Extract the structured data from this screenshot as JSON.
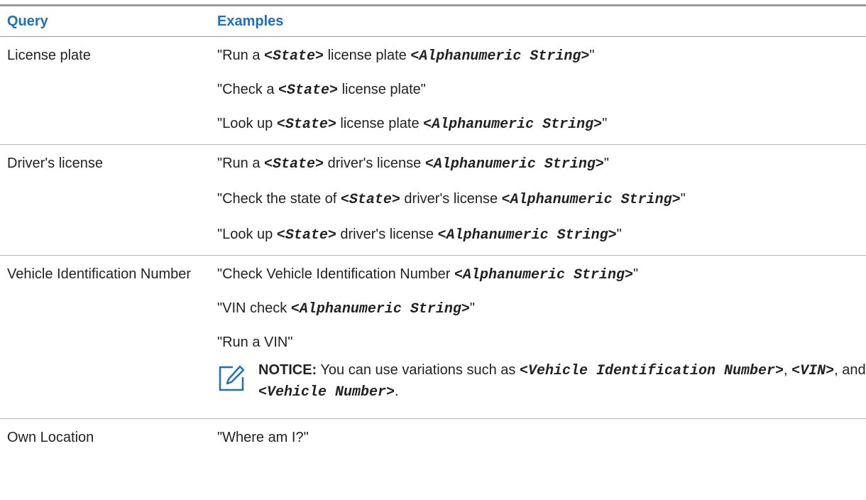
{
  "table": {
    "headers": {
      "query": "Query",
      "examples": "Examples"
    },
    "rows": [
      {
        "query": "License plate",
        "examples": [
          {
            "prefix": "\"Run a ",
            "p1": "<State>",
            "mid": " license plate ",
            "p2": "<Alphanumeric String>",
            "suffix": "\""
          },
          {
            "prefix": "\"Check a ",
            "p1": "<State>",
            "mid": " license plate\"",
            "p2": "",
            "suffix": ""
          },
          {
            "prefix": "\"Look up ",
            "p1": "<State>",
            "mid": " license plate ",
            "p2": "<Alphanumeric String>",
            "suffix": "\""
          }
        ]
      },
      {
        "query": "Driver's license",
        "examples": [
          {
            "prefix": "\"Run a ",
            "p1": "<State>",
            "mid": " driver's license ",
            "p2": "<Alphanumeric String>",
            "suffix": "\""
          },
          {
            "prefix": "\"Check the state of ",
            "p1": "<State>",
            "mid": " driver's license ",
            "p2": "<Alphanumeric String>",
            "suffix": "\""
          },
          {
            "prefix": "\"Look up ",
            "p1": "<State>",
            "mid": " driver's license ",
            "p2": "<Alphanumeric String>",
            "suffix": "\""
          }
        ]
      },
      {
        "query": "Vehicle Identification Number",
        "examples": [
          {
            "prefix": "\"Check Vehicle Identification Number ",
            "p1": "<Alphanumeric String>",
            "mid": "\"",
            "p2": "",
            "suffix": ""
          },
          {
            "prefix": "\"VIN check ",
            "p1": "<Alphanumeric String>",
            "mid": "\"",
            "p2": "",
            "suffix": ""
          },
          {
            "prefix": "\"Run a VIN\"",
            "p1": "",
            "mid": "",
            "p2": "",
            "suffix": ""
          }
        ],
        "notice": {
          "label": "NOTICE:",
          "text1": " You can use variations such as ",
          "v1": "<Vehicle Identification Number>",
          "sep1": ", ",
          "v2": "<VIN>",
          "sep2": ", and ",
          "v3": "<Vehicle Number>",
          "end": "."
        }
      },
      {
        "query": "Own Location",
        "examples": [
          {
            "prefix": "\"Where am I?\"",
            "p1": "",
            "mid": "",
            "p2": "",
            "suffix": ""
          }
        ]
      }
    ]
  },
  "colors": {
    "header_text": "#1f6fc0",
    "notice_icon": "#1f6fc0",
    "rule": "#9a9a9a"
  },
  "icons": {
    "notice": "notice-pencil-icon"
  }
}
